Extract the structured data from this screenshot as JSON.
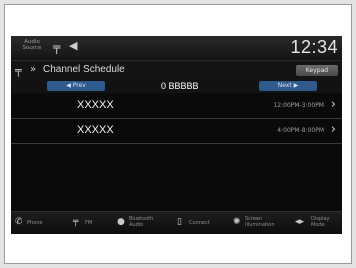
{
  "status": {
    "audio_source": "Audio\nSource",
    "clock": "12:34"
  },
  "header": {
    "title": "Channel Schedule",
    "button": "Keypad"
  },
  "nav": {
    "prev": "Prev",
    "next": "Next",
    "channel": "0  BBBBB"
  },
  "schedule": [
    {
      "program": "XXXXX",
      "time": "12:00PM-3:00PM"
    },
    {
      "program": "XXXXX",
      "time": "4:00PM-8:00PM"
    }
  ],
  "bottom_bar": [
    {
      "icon": "phone-icon",
      "label": "Phone"
    },
    {
      "icon": "fm-icon",
      "label": "FM"
    },
    {
      "icon": "bluetooth-icon",
      "label": "Bluetooth\nAudio"
    },
    {
      "icon": "connect-icon",
      "label": "Connect"
    },
    {
      "icon": "brightness-icon",
      "label": "Screen\nIllumination"
    },
    {
      "icon": "display-mode-icon",
      "label": "Display\nMode"
    }
  ]
}
